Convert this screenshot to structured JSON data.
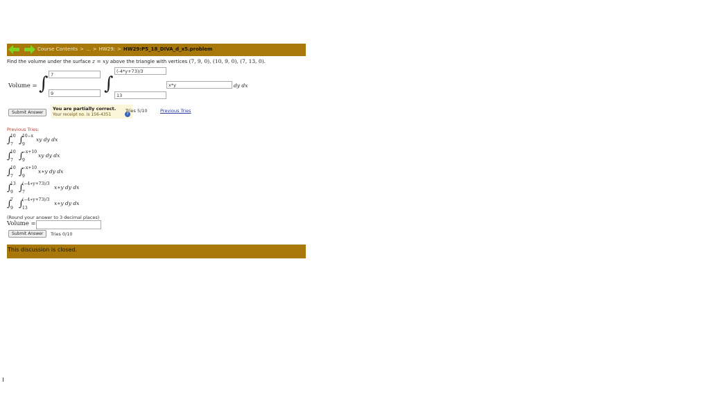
{
  "breadcrumb": {
    "items": [
      "Course Contents",
      "...",
      "HW29:",
      "HW29:P5_18_DIVA_d_x5.problem"
    ]
  },
  "question": {
    "prefix": "Find the volume under the surface ",
    "surface": "z = xy",
    "middle": " above the triangle with vertices ",
    "vertices": "(7, 9, 0), (10, 9, 0), (7, 13, 0)."
  },
  "answer": {
    "volume_label": "Volume =",
    "outer_upper": "7",
    "outer_lower": "9",
    "inner_upper": "(-4*y+73)/3",
    "inner_lower": "13",
    "integrand": "x*y",
    "differentials": "dy dx"
  },
  "submit": {
    "button_label": "Submit Answer",
    "feedback_title": "You are partially correct.",
    "receipt": "Your receipt no. is 156-4351",
    "tries": "Tries 5/10",
    "previous_tries_link": "Previous Tries"
  },
  "previous_tries": {
    "title": "Previous Tries:",
    "items": [
      {
        "outer_up": "10",
        "outer_low": "7",
        "inner_up": "10−x",
        "inner_low": "9",
        "expr": "xy dy dx"
      },
      {
        "outer_up": "10",
        "outer_low": "7",
        "inner_up": "−x+10",
        "inner_low": "9",
        "expr": "xy dy dx"
      },
      {
        "outer_up": "10",
        "outer_low": "7",
        "inner_up": "−x+10",
        "inner_low": "9",
        "expr": "x∗y dy dx"
      },
      {
        "outer_up": "13",
        "outer_low": "9",
        "inner_up": "(−4∗y+73)/3",
        "inner_low": "7",
        "expr": "x∗y dy dx"
      },
      {
        "outer_up": "7",
        "outer_low": "9",
        "inner_up": "(−4∗y+73)/3",
        "inner_low": "13",
        "expr": "x∗y dy dx"
      }
    ]
  },
  "part2": {
    "round_note": "(Round your answer to 3 decimal places)",
    "volume_label": "Volume =",
    "button_label": "Submit Answer",
    "tries": "Tries 0/10"
  },
  "discussion": {
    "closed_text": "This discussion is closed."
  },
  "colors": {
    "bar": "#a8790a",
    "arrow": "#7ed321",
    "feedback_bg": "#fbf6d9",
    "prev_title": "#c0392b"
  }
}
